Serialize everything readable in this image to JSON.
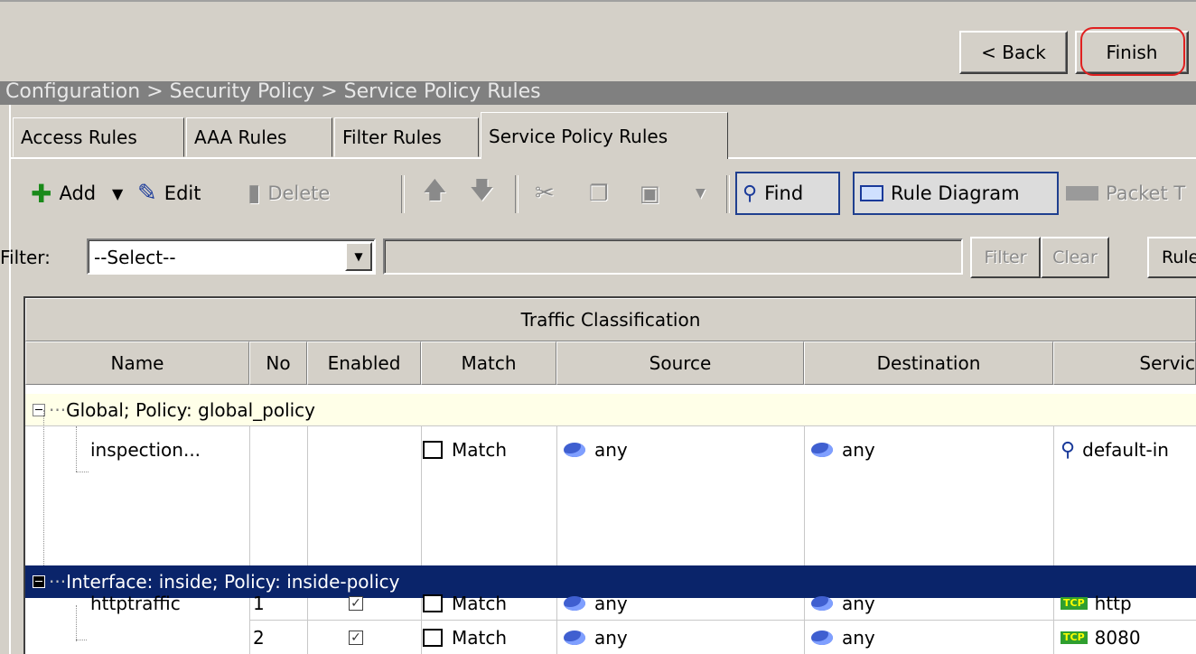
{
  "wizard": {
    "back_label": "< Back",
    "finish_label": "Finish"
  },
  "breadcrumb": "Configuration > Security Policy > Service Policy Rules",
  "tabs": [
    {
      "label": "Access Rules"
    },
    {
      "label": "AAA Rules"
    },
    {
      "label": "Filter Rules"
    },
    {
      "label": "Service Policy Rules",
      "active": true
    }
  ],
  "toolbar": {
    "add": "Add",
    "edit": "Edit",
    "delete": "Delete",
    "find": "Find",
    "rule_diagram": "Rule Diagram",
    "packet_trace": "Packet T"
  },
  "filter": {
    "label": "Filter:",
    "select_value": "--Select--",
    "filter_btn": "Filter",
    "clear_btn": "Clear",
    "rule_btn": "Rule"
  },
  "table": {
    "group_header": "Traffic Classification",
    "columns": [
      "Name",
      "No",
      "Enabled",
      "Match",
      "Source",
      "Destination",
      "Servic"
    ],
    "groups": [
      {
        "label": "Global; Policy: global_policy",
        "rows": [
          {
            "name": "inspection...",
            "no": "",
            "enabled": null,
            "match": "Match",
            "source": "any",
            "destination": "any",
            "service": "default-in"
          }
        ]
      },
      {
        "label": "Interface: inside; Policy: inside-policy",
        "rows": [
          {
            "name": "httptraffic",
            "no": "1",
            "enabled": true,
            "match": "Match",
            "source": "any",
            "destination": "any",
            "service": "http",
            "service_proto": "TCP"
          },
          {
            "name": "",
            "no": "2",
            "enabled": true,
            "match": "Match",
            "source": "any",
            "destination": "any",
            "service": "8080",
            "service_proto": "TCP"
          }
        ]
      }
    ]
  },
  "colors": {
    "selected_group_bg": "#0a246a",
    "global_group_bg": "#ffffe8",
    "finish_highlight": "#e02020"
  }
}
